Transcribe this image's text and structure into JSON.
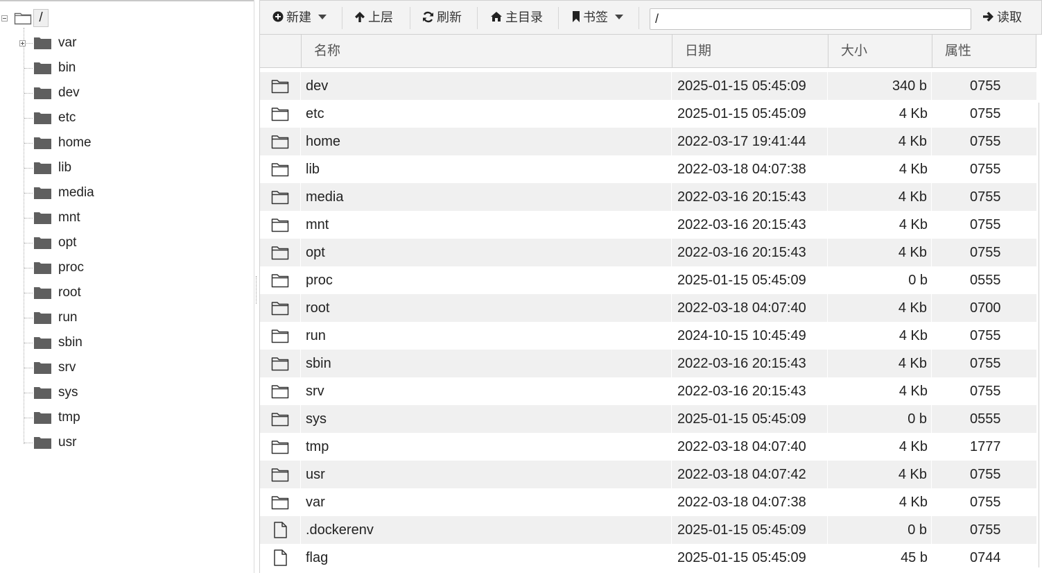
{
  "tree": {
    "root_label": "/",
    "items": [
      {
        "label": "var",
        "expandable": true
      },
      {
        "label": "bin"
      },
      {
        "label": "dev"
      },
      {
        "label": "etc"
      },
      {
        "label": "home"
      },
      {
        "label": "lib"
      },
      {
        "label": "media"
      },
      {
        "label": "mnt"
      },
      {
        "label": "opt"
      },
      {
        "label": "proc"
      },
      {
        "label": "root"
      },
      {
        "label": "run"
      },
      {
        "label": "sbin"
      },
      {
        "label": "srv"
      },
      {
        "label": "sys"
      },
      {
        "label": "tmp"
      },
      {
        "label": "usr"
      }
    ]
  },
  "toolbar": {
    "new_label": "新建",
    "up_label": "上层",
    "refresh_label": "刷新",
    "home_label": "主目录",
    "bookmarks_label": "书签",
    "path_value": "/",
    "read_label": "读取"
  },
  "columns": {
    "name": "名称",
    "date": "日期",
    "size": "大小",
    "attr": "属性"
  },
  "files": [
    {
      "type": "folder",
      "name": "dev",
      "date": "2025-01-15 05:45:09",
      "size": "340 b",
      "attr": "0755"
    },
    {
      "type": "folder",
      "name": "etc",
      "date": "2025-01-15 05:45:09",
      "size": "4 Kb",
      "attr": "0755"
    },
    {
      "type": "folder",
      "name": "home",
      "date": "2022-03-17 19:41:44",
      "size": "4 Kb",
      "attr": "0755"
    },
    {
      "type": "folder",
      "name": "lib",
      "date": "2022-03-18 04:07:38",
      "size": "4 Kb",
      "attr": "0755"
    },
    {
      "type": "folder",
      "name": "media",
      "date": "2022-03-16 20:15:43",
      "size": "4 Kb",
      "attr": "0755"
    },
    {
      "type": "folder",
      "name": "mnt",
      "date": "2022-03-16 20:15:43",
      "size": "4 Kb",
      "attr": "0755"
    },
    {
      "type": "folder",
      "name": "opt",
      "date": "2022-03-16 20:15:43",
      "size": "4 Kb",
      "attr": "0755"
    },
    {
      "type": "folder",
      "name": "proc",
      "date": "2025-01-15 05:45:09",
      "size": "0 b",
      "attr": "0555"
    },
    {
      "type": "folder",
      "name": "root",
      "date": "2022-03-18 04:07:40",
      "size": "4 Kb",
      "attr": "0700"
    },
    {
      "type": "folder",
      "name": "run",
      "date": "2024-10-15 10:45:49",
      "size": "4 Kb",
      "attr": "0755"
    },
    {
      "type": "folder",
      "name": "sbin",
      "date": "2022-03-16 20:15:43",
      "size": "4 Kb",
      "attr": "0755"
    },
    {
      "type": "folder",
      "name": "srv",
      "date": "2022-03-16 20:15:43",
      "size": "4 Kb",
      "attr": "0755"
    },
    {
      "type": "folder",
      "name": "sys",
      "date": "2025-01-15 05:45:09",
      "size": "0 b",
      "attr": "0555"
    },
    {
      "type": "folder",
      "name": "tmp",
      "date": "2022-03-18 04:07:40",
      "size": "4 Kb",
      "attr": "1777"
    },
    {
      "type": "folder",
      "name": "usr",
      "date": "2022-03-18 04:07:42",
      "size": "4 Kb",
      "attr": "0755"
    },
    {
      "type": "folder",
      "name": "var",
      "date": "2022-03-18 04:07:38",
      "size": "4 Kb",
      "attr": "0755"
    },
    {
      "type": "file",
      "name": ".dockerenv",
      "date": "2025-01-15 05:45:09",
      "size": "0 b",
      "attr": "0755"
    },
    {
      "type": "file",
      "name": "flag",
      "date": "2025-01-15 05:45:09",
      "size": "45 b",
      "attr": "0744"
    }
  ]
}
